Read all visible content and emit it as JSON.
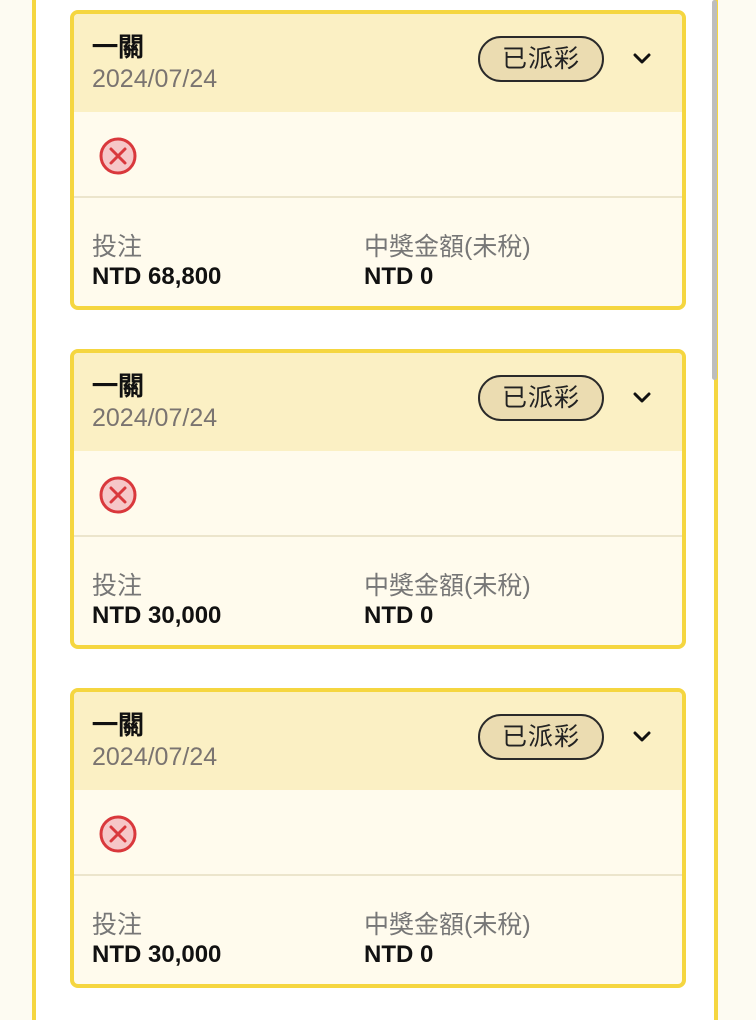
{
  "tickets": [
    {
      "title": "一關",
      "date": "2024/07/24",
      "status": "已派彩",
      "result_icon": "x-circle-icon",
      "bet_label": "投注",
      "bet_value": "NTD 68,800",
      "win_label": "中獎金額(未稅)",
      "win_value": "NTD 0"
    },
    {
      "title": "一關",
      "date": "2024/07/24",
      "status": "已派彩",
      "result_icon": "x-circle-icon",
      "bet_label": "投注",
      "bet_value": "NTD 30,000",
      "win_label": "中獎金額(未稅)",
      "win_value": "NTD 0"
    },
    {
      "title": "一關",
      "date": "2024/07/24",
      "status": "已派彩",
      "result_icon": "x-circle-icon",
      "bet_label": "投注",
      "bet_value": "NTD 30,000",
      "win_label": "中獎金額(未稅)",
      "win_value": "NTD 0"
    }
  ],
  "colors": {
    "accent_border": "#f5d640",
    "header_bg": "#fbf0c4",
    "card_bg": "#fffbed",
    "badge_bg": "#ebdcb1",
    "lose_red": "#d9383c"
  }
}
